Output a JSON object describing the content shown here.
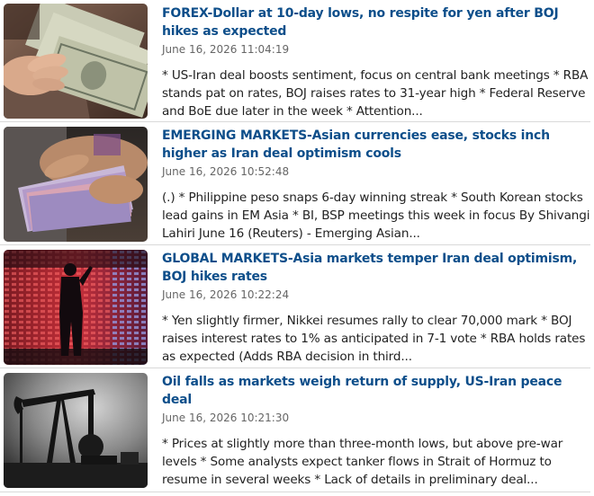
{
  "articles": [
    {
      "headline": "FOREX-Dollar at 10-day lows, no respite for yen after BOJ hikes as expected",
      "timestamp": "June 16, 2026 11:04:19",
      "summary": "* US-Iran deal boosts sentiment, focus on central bank meetings * RBA stands pat on rates, BOJ raises rates to 31-year high * Federal Reserve and BoE due later in the week * Attention...",
      "image": "dollar-bills-photo"
    },
    {
      "headline": "EMERGING MARKETS-Asian currencies ease, stocks inch higher as Iran deal optimism cools",
      "timestamp": "June 16, 2026 10:52:48",
      "summary": "(.) * Philippine peso snaps 6-day winning streak * South Korean stocks lead gains in EM Asia * BI, BSP meetings this week in focus By Shivangi Lahiri June 16 (Reuters) - Emerging Asian...",
      "image": "currency-notes-photo"
    },
    {
      "headline": "GLOBAL MARKETS-Asia markets temper Iran deal optimism, BOJ hikes rates",
      "timestamp": "June 16, 2026 10:22:24",
      "summary": "* Yen slightly firmer, Nikkei resumes rally to clear 70,000 mark * BOJ raises interest rates to 1% as anticipated in 7-1 vote * RBA holds rates as expected (Adds RBA decision in third...",
      "image": "stock-board-silhouette-photo"
    },
    {
      "headline": "Oil falls as markets weigh return of supply, US-Iran peace deal",
      "timestamp": "June 16, 2026 10:21:30",
      "summary": "* Prices at slightly more than three-month lows, but above pre-war levels * Some analysts expect tanker flows in Strait of Hormuz to resume in several weeks * Lack of details in preliminary deal...",
      "image": "oil-pumpjack-photo"
    }
  ]
}
